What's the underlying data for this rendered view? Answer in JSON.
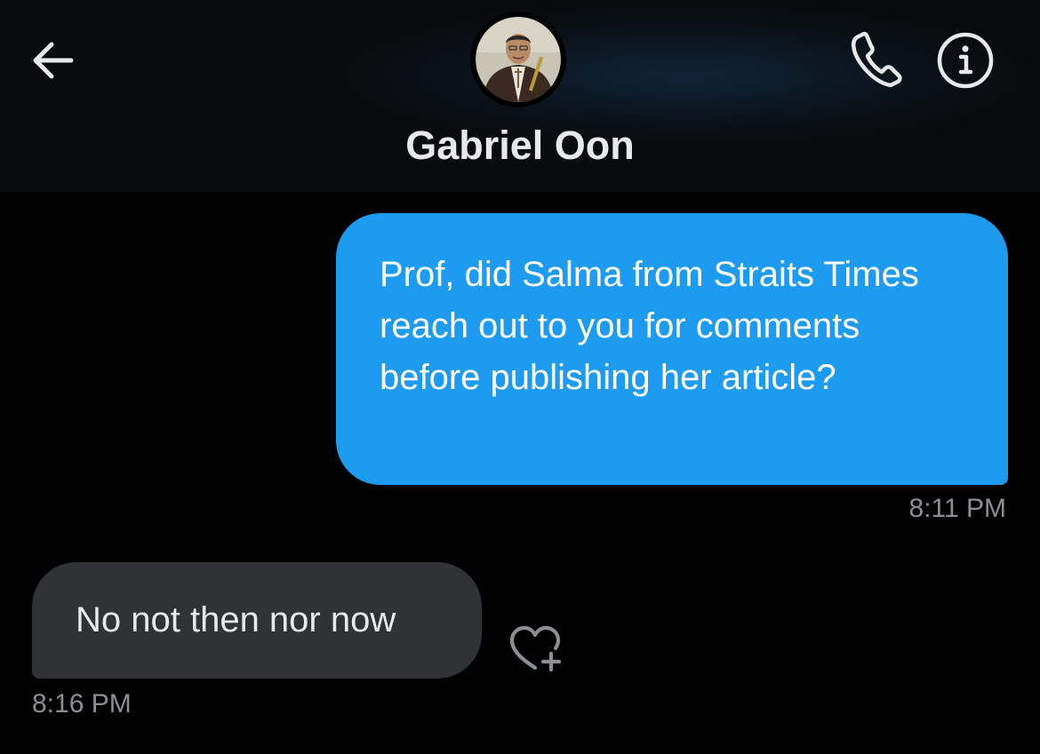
{
  "header": {
    "contact_name": "Gabriel Oon",
    "back_icon": "arrow-left-icon",
    "call_icon": "phone-icon",
    "info_icon": "info-icon"
  },
  "messages": [
    {
      "direction": "outgoing",
      "text": "Prof, did Salma from Straits Times reach out to you for comments before publishing her article?",
      "time": "8:11 PM"
    },
    {
      "direction": "incoming",
      "text": "No not then nor now",
      "time": "8:16 PM"
    }
  ],
  "colors": {
    "background": "#000000",
    "header_background": "#0a0b0d",
    "outgoing_bubble": "#1d9bf0",
    "incoming_bubble": "#2f3336",
    "timestamp": "#8b8f93",
    "icon": "#e7e9ea"
  }
}
